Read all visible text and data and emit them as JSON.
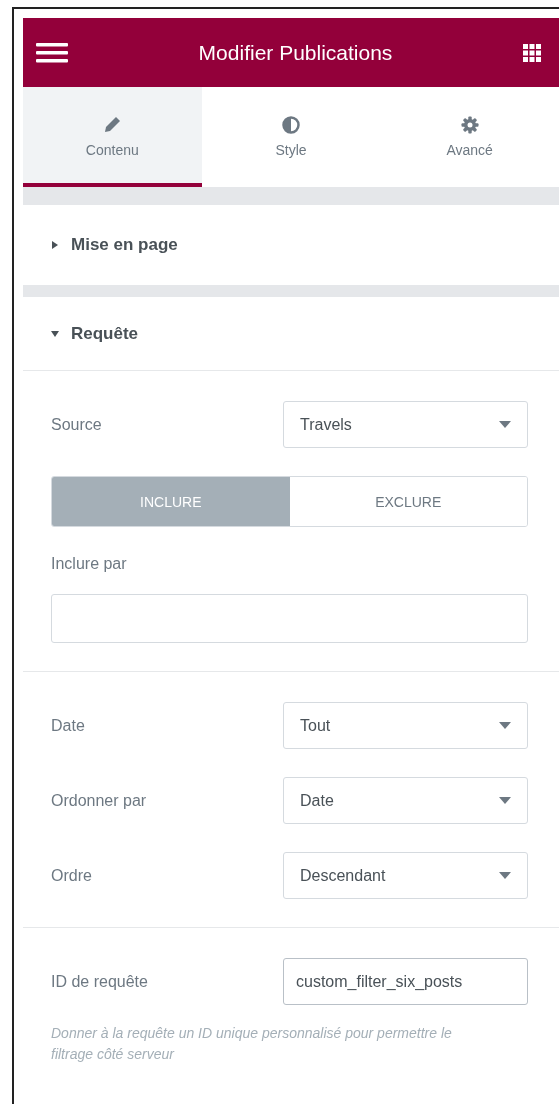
{
  "header": {
    "title": "Modifier Publications"
  },
  "tabs": [
    {
      "label": "Contenu",
      "selected": true
    },
    {
      "label": "Style",
      "selected": false
    },
    {
      "label": "Avancé",
      "selected": false
    }
  ],
  "sections": [
    {
      "title": "Mise en page",
      "expanded": false
    },
    {
      "title": "Requête",
      "expanded": true,
      "groups": [
        [
          {
            "kind": "select",
            "label": "Source",
            "value": "Travels"
          },
          {
            "kind": "toggle",
            "options": [
              {
                "label": "INCLURE",
                "selected": true
              },
              {
                "label": "EXCLURE",
                "selected": false
              }
            ]
          },
          {
            "kind": "block-input",
            "label": "Inclure par"
          }
        ],
        [
          {
            "kind": "select",
            "label": "Date",
            "value": "Tout"
          },
          {
            "kind": "select",
            "label": "Ordonner par",
            "value": "Date"
          },
          {
            "kind": "select",
            "label": "Ordre",
            "value": "Descendant"
          }
        ],
        [
          {
            "kind": "text",
            "label": "ID de requête",
            "value": "custom_filter_six_posts",
            "description": "Donner à la requête un ID unique personnalisé pour permettre le filtrage côté serveur"
          }
        ]
      ]
    }
  ]
}
